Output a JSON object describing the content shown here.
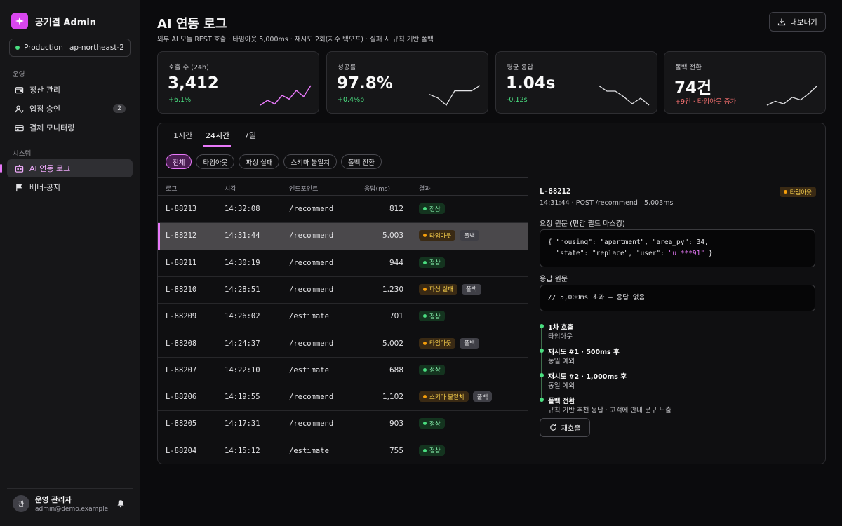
{
  "app": {
    "brand": "공기결 Admin"
  },
  "env": {
    "name": "Production",
    "region": "ap-northeast-2"
  },
  "sidebar": {
    "section_ops": "운영",
    "section_sys": "시스템",
    "items": [
      {
        "label": "정산 관리",
        "icon": "wallet-icon"
      },
      {
        "label": "입점 승인",
        "icon": "user-check-icon",
        "badge": "2"
      },
      {
        "label": "결제 모니터링",
        "icon": "credit-card-icon"
      },
      {
        "label": "AI 연동 로그",
        "icon": "robot-icon",
        "active": true
      },
      {
        "label": "배너·공지",
        "icon": "flag-icon"
      }
    ]
  },
  "user": {
    "initial": "관",
    "name": "운영 관리자",
    "email": "admin@demo.example"
  },
  "header": {
    "title": "AI 연동 로그",
    "subtitle": "외부 AI 모듈 REST 호출 · 타임아웃 5,000ms · 재시도 2회(지수 백오프) · 실패 시 규칙 기반 폴백",
    "export_label": "내보내기"
  },
  "kpis": [
    {
      "label": "호출 수 (24h)",
      "value": "3,412",
      "delta": "+6.1%",
      "delta_color": "#4ade80",
      "spark_color": "#e879f9",
      "spark": [
        2,
        6,
        3,
        10,
        7,
        14,
        9,
        18
      ]
    },
    {
      "label": "성공률",
      "value": "97.8%",
      "delta": "+0.4%p",
      "delta_color": "#4ade80",
      "spark_color": "#e4e4e7",
      "spark": [
        8,
        6,
        2,
        10,
        10,
        10,
        13
      ]
    },
    {
      "label": "평균 응답",
      "value": "1.04s",
      "delta": "-0.12s",
      "delta_color": "#4ade80",
      "spark_color": "#e4e4e7",
      "spark": [
        16,
        12,
        12,
        8,
        3,
        7,
        2
      ]
    },
    {
      "label": "폴백 전환",
      "value": "74건",
      "delta": "+9건 · 타임아웃 증가",
      "delta_color": "#f87171",
      "spark_color": "#e4e4e7",
      "spark": [
        2,
        5,
        3,
        8,
        6,
        11,
        17
      ]
    }
  ],
  "tabs": [
    "1시간",
    "24시간",
    "7일"
  ],
  "active_tab": 1,
  "filters": [
    "전체",
    "타임아웃",
    "파싱 실패",
    "스키마 불일치",
    "폴백 전환"
  ],
  "table": {
    "headers": [
      "로그",
      "시각",
      "엔드포인트",
      "응답(ms)",
      "결과"
    ],
    "rows": [
      {
        "id": "L-88213",
        "time": "14:32:08",
        "endpoint": "/recommend",
        "latency": "812",
        "result": "정상",
        "kind": "ok",
        "fallback": ""
      },
      {
        "id": "L-88212",
        "time": "14:31:44",
        "endpoint": "/recommend",
        "latency": "5,003",
        "result": "타임아웃",
        "kind": "warn",
        "fallback": "폴백",
        "selected": true
      },
      {
        "id": "L-88211",
        "time": "14:30:19",
        "endpoint": "/recommend",
        "latency": "944",
        "result": "정상",
        "kind": "ok",
        "fallback": ""
      },
      {
        "id": "L-88210",
        "time": "14:28:51",
        "endpoint": "/recommend",
        "latency": "1,230",
        "result": "파싱 실패",
        "kind": "warn",
        "fallback": "폴백"
      },
      {
        "id": "L-88209",
        "time": "14:26:02",
        "endpoint": "/estimate",
        "latency": "701",
        "result": "정상",
        "kind": "ok",
        "fallback": ""
      },
      {
        "id": "L-88208",
        "time": "14:24:37",
        "endpoint": "/recommend",
        "latency": "5,002",
        "result": "타임아웃",
        "kind": "warn",
        "fallback": "폴백"
      },
      {
        "id": "L-88207",
        "time": "14:22:10",
        "endpoint": "/estimate",
        "latency": "688",
        "result": "정상",
        "kind": "ok",
        "fallback": ""
      },
      {
        "id": "L-88206",
        "time": "14:19:55",
        "endpoint": "/recommend",
        "latency": "1,102",
        "result": "스키마 불일치",
        "kind": "warn",
        "fallback": "폴백"
      },
      {
        "id": "L-88205",
        "time": "14:17:31",
        "endpoint": "/recommend",
        "latency": "903",
        "result": "정상",
        "kind": "ok",
        "fallback": ""
      },
      {
        "id": "L-88204",
        "time": "14:15:12",
        "endpoint": "/estimate",
        "latency": "755",
        "result": "정상",
        "kind": "ok",
        "fallback": ""
      }
    ]
  },
  "detail": {
    "id": "L-88212",
    "status": "타임아웃",
    "meta": "14:31:44 · POST /recommend · 5,003ms",
    "request_label": "요청 원문 (민감 필드 마스킹)",
    "request_line1": "{ \"housing\": \"apartment\", \"area_py\": 34,",
    "request_line2_a": "  \"state\": \"replace\", \"user\": ",
    "request_line2_masked": "\"u_***91\"",
    "request_line2_b": " }",
    "response_label": "응답 원문",
    "response_body": "// 5,000ms 초과 — 응답 없음",
    "timeline": [
      {
        "title": "1차 호출",
        "desc": "타임아웃"
      },
      {
        "title": "재시도 #1 · 500ms 후",
        "desc": "동일 예외"
      },
      {
        "title": "재시도 #2 · 1,000ms 후",
        "desc": "동일 예외"
      },
      {
        "title": "폴백 전환",
        "desc": "규칙 기반 추천 응답 · 고객에 안내 문구 노출"
      }
    ],
    "retry_label": "재호출"
  }
}
